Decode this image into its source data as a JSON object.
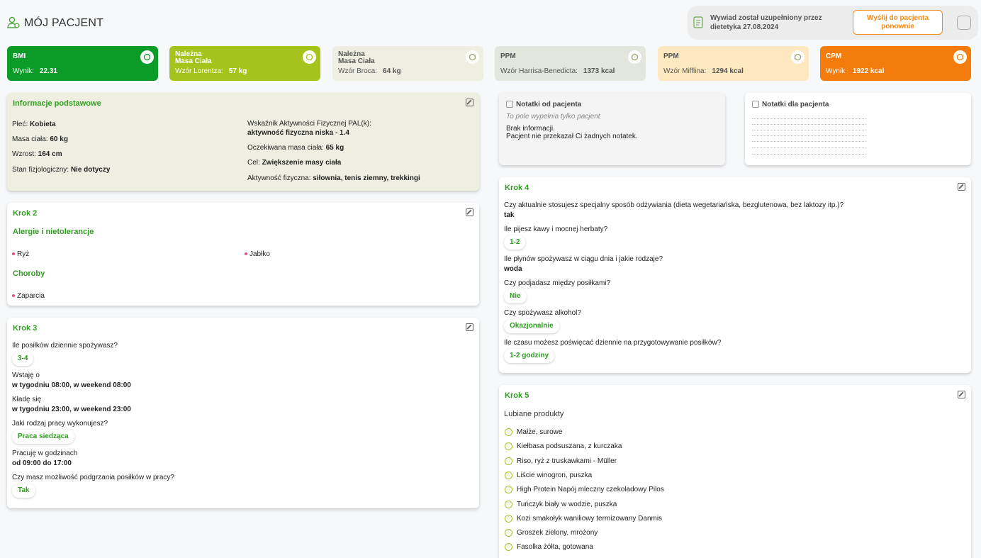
{
  "header": {
    "title": "MÓJ PACJENT",
    "info_text": "Wywiad został uzupełniony przez dietetyka 27.08.2024",
    "resend_label": "Wyślij do pacjenta ponownie"
  },
  "stats": [
    {
      "name": "BMI",
      "label": "Wynik:",
      "value": "22.31",
      "bg": "#0a9c27",
      "color": "#ffffff"
    },
    {
      "name": "Należna\nMasa Ciała",
      "label": "Wzór Lorentza:",
      "value": "57 kg",
      "bg": "#a6c31c",
      "color": "#ffffff"
    },
    {
      "name": "Należna\nMasa Ciała",
      "label": "Wzór Broca:",
      "value": "64 kg",
      "bg": "#efefe1",
      "color": "#555555"
    },
    {
      "name": "PPM",
      "label": "Wzór Harrisa-Benedicta:",
      "value": "1373 kcal",
      "bg": "#e2e6dd",
      "color": "#555555"
    },
    {
      "name": "PPM",
      "label": "Wzór Mifflina:",
      "value": "1294 kcal",
      "bg": "#fde8bf",
      "color": "#555555"
    },
    {
      "name": "CPM",
      "label": "Wynik:",
      "value": "1922 kcal",
      "bg": "#f47c0c",
      "color": "#ffffff"
    }
  ],
  "basic": {
    "title": "Informacje podstawowe",
    "sex_label": "Płeć:",
    "sex": "Kobieta",
    "mass_label": "Masa ciała:",
    "mass": "60 kg",
    "height_label": "Wzrost:",
    "height": "164 cm",
    "phys_label": "Stan fizjologiczny:",
    "phys": "Nie dotyczy",
    "pal_label": "Wskaźnik Aktywności Fizycznej PAL(k):",
    "pal": "aktywność fizyczna niska - 1.4",
    "target_label": "Oczekiwana masa ciała:",
    "target": "65 kg",
    "goal_label": "Cel:",
    "goal": "Zwiększenie masy ciała",
    "activity_label": "Aktywność fizyczna:",
    "activity": "siłownia, tenis ziemny, trekkingi"
  },
  "step2": {
    "title": "Krok 2",
    "allergies_title": "Alergie i nietolerancje",
    "allergies": [
      "Ryż",
      "Jabłko"
    ],
    "diseases_title": "Choroby",
    "diseases": [
      "Zaparcia"
    ]
  },
  "step3": {
    "title": "Krok 3",
    "q1": "Ile posiłków dziennie spożywasz?",
    "a1": "3-4",
    "q2": "Wstaję o",
    "a2": "w tygodniu 08:00, w weekend 08:00",
    "q3": "Kładę się",
    "a3": "w tygodniu 23:00, w weekend 23:00",
    "q4": "Jaki rodzaj pracy wykonujesz?",
    "a4": "Praca siedząca",
    "q5": "Pracuję w godzinach",
    "a5": "od 09:00 do 17:00",
    "q6": "Czy masz możliwość podgrzania posiłków w pracy?",
    "a6": "Tak"
  },
  "notes_from": {
    "title": "Notatki od pacjenta",
    "hint": "To pole wypełnia tylko pacjent",
    "line1": "Brak informacji.",
    "line2": "Pacjent nie przekazał Ci żadnych notatek."
  },
  "notes_for": {
    "title": "Notatki dla pacjenta"
  },
  "step4": {
    "title": "Krok 4",
    "q1": "Czy aktualnie stosujesz specjalny sposób odżywiania (dieta wegetariańska, bezglutenowa, bez laktozy itp.)?",
    "a1": "tak",
    "q2": "Ile pijesz kawy i mocnej herbaty?",
    "a2": "1-2",
    "q3": "Ile płynów spożywasz w ciągu dnia i jakie rodzaje?",
    "a3": "woda",
    "q4": "Czy podjadasz między posiłkami?",
    "a4": "Nie",
    "q5": "Czy spożywasz alkohol?",
    "a5": "Okazjonalnie",
    "q6": "Ile czasu możesz poświęcać dziennie na przygotowywanie posiłków?",
    "a6": "1-2 godziny"
  },
  "step5": {
    "title": "Krok 5",
    "liked_title": "Lubiane produkty",
    "products": [
      "Małże, surowe",
      "Kiełbasa podsuszana, z kurczaka",
      "Riso, ryż z truskawkami - Müller",
      "Liście winogron, puszka",
      "High Protein Napój mleczny czekoladowy Pilos",
      "Tuńczyk biały w wodzie, puszka",
      "Kozi smakołyk waniliowy termizowany Danmis",
      "Groszek zielony, mrożony",
      "Fasolka żółta, gotowana"
    ]
  }
}
